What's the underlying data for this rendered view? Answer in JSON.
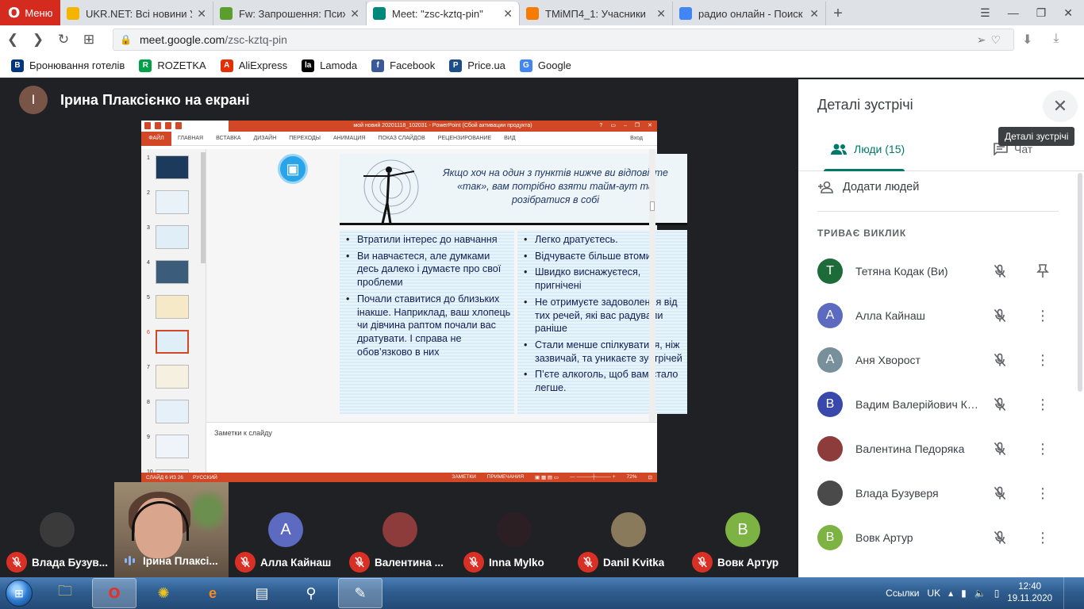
{
  "browser": {
    "menu_label": "Меню",
    "tabs": [
      {
        "title": "UKR.NET: Всі новини України",
        "color": "#f4b400"
      },
      {
        "title": "Fw: Запрошення: Психологічна",
        "color": "#5a9e2d"
      },
      {
        "title": "Meet: \"zsc-kztq-pin\"",
        "color": "#00897b"
      },
      {
        "title": "ТМіМП4_1: Учасники",
        "color": "#f57c00"
      },
      {
        "title": "радио онлайн - Поиск в Google",
        "color": "#4285f4"
      }
    ],
    "url_host": "meet.google.com",
    "url_path": "/zsc-kztq-pin",
    "bookmarks": [
      {
        "label": "Бронювання готелів",
        "icon": "B",
        "color": "#003580"
      },
      {
        "label": "ROZETKA",
        "icon": "R",
        "color": "#00a046"
      },
      {
        "label": "AliExpress",
        "icon": "A",
        "color": "#e62e04"
      },
      {
        "label": "Lamoda",
        "icon": "la",
        "color": "#000000"
      },
      {
        "label": "Facebook",
        "icon": "f",
        "color": "#3b5998"
      },
      {
        "label": "Price.ua",
        "icon": "P",
        "color": "#1d4e89"
      },
      {
        "label": "Google",
        "icon": "G",
        "color": "#4285f4"
      }
    ]
  },
  "presenter": {
    "initial": "І",
    "label": "Ірина Плаксієнко на екрані"
  },
  "ppt": {
    "window_title": "мой новий 20201118_102031 - PowerPoint (Сбой активации продукта)",
    "ribbon_tabs": [
      "ФАЙЛ",
      "ГЛАВНАЯ",
      "ВСТАВКА",
      "ДИЗАЙН",
      "ПЕРЕХОДЫ",
      "АНИМАЦИЯ",
      "ПОКАЗ СЛАЙДОВ",
      "РЕЦЕНЗИРОВАНИЕ",
      "ВИД"
    ],
    "login": "Вход",
    "thumb_numbers": [
      "1",
      "2",
      "3",
      "4",
      "5",
      "6",
      "7",
      "8",
      "9",
      "10"
    ],
    "selected_slide": 6,
    "slide_header": "Якщо хоч на один з пунктів нижче ви відповісте «так», вам потрібно взяти тайм-аут та розібратися в собі",
    "left_bullets": [
      "Втратили інтерес до навчання",
      "Ви навчаєтеся, але думками десь далеко і думаєте про свої проблеми",
      "Почали ставитися до близьких інакше. Наприклад, ваш хлопець чи дівчина раптом  почали вас дратувати. І справа не обов’язково в них"
    ],
    "right_bullets": [
      " Легко дратуєтесь.",
      " Відчуваєте більше втоми.",
      "Швидко виснажуєтеся, пригнічені",
      "Не отримуєте задоволення від тих речей, які вас радували раніше",
      "Стали менше спілкуватися, ніж зазвичай, та уникаєте зустрічей",
      "П’єте алкоголь, щоб вам стало легше."
    ],
    "notes_placeholder": "Заметки к слайду",
    "status_slide": "СЛАЙД 6 ИЗ 26",
    "status_lang": "РУССКИЙ",
    "status_notes": "ЗАМЕТКИ",
    "status_comments": "ПРИМЕЧАНИЯ",
    "zoom": "72%"
  },
  "panel": {
    "title": "Деталі зустрічі",
    "tooltip": "Деталі зустрічі",
    "tab_people": "Люди (15)",
    "tab_chat": "Чат",
    "add_people": "Додати людей",
    "section": "ТРИВАЄ ВИКЛИК",
    "people": [
      {
        "name": "Тетяна Кодак (Ви)",
        "initial": "Т",
        "color": "#1e6b3a",
        "action": "pin"
      },
      {
        "name": "Алла Кайнаш",
        "initial": "А",
        "color": "#5c6bc0",
        "action": "more"
      },
      {
        "name": "Аня Хворост",
        "initial": "А",
        "color": "#78909c",
        "action": "more"
      },
      {
        "name": "Вадим Валерійович Ко...",
        "initial": "В",
        "color": "#3949ab",
        "action": "more"
      },
      {
        "name": "Валентина Педоряка",
        "initial": "",
        "color": "#8d3b3b",
        "action": "more"
      },
      {
        "name": "Влада Бузуверя",
        "initial": "",
        "color": "#4a4a4a",
        "action": "more"
      },
      {
        "name": "Вовк Артур",
        "initial": "В",
        "color": "#7cb342",
        "action": "more"
      }
    ]
  },
  "filmstrip": [
    {
      "name": "Влада Бузув...",
      "initial": "",
      "color": "#3a3a3a",
      "muted": true,
      "video": false
    },
    {
      "name": "Ірина Плаксі...",
      "initial": "",
      "color": "#7d6b58",
      "muted": false,
      "video": true
    },
    {
      "name": "Алла Кайнаш",
      "initial": "А",
      "color": "#5c6bc0",
      "muted": true,
      "video": false
    },
    {
      "name": "Валентина ...",
      "initial": "",
      "color": "#8d3b3b",
      "muted": true,
      "video": false
    },
    {
      "name": "Inna Mylko",
      "initial": "",
      "color": "#2b1f24",
      "muted": true,
      "video": false
    },
    {
      "name": "Danil Kvitka",
      "initial": "",
      "color": "#8a7a5c",
      "muted": true,
      "video": false
    },
    {
      "name": "Вовк Артур",
      "initial": "В",
      "color": "#7cb342",
      "muted": true,
      "video": false
    }
  ],
  "taskbar": {
    "lang": "UK",
    "links_label": "Ссылки",
    "time": "12:40",
    "date": "19.11.2020"
  }
}
